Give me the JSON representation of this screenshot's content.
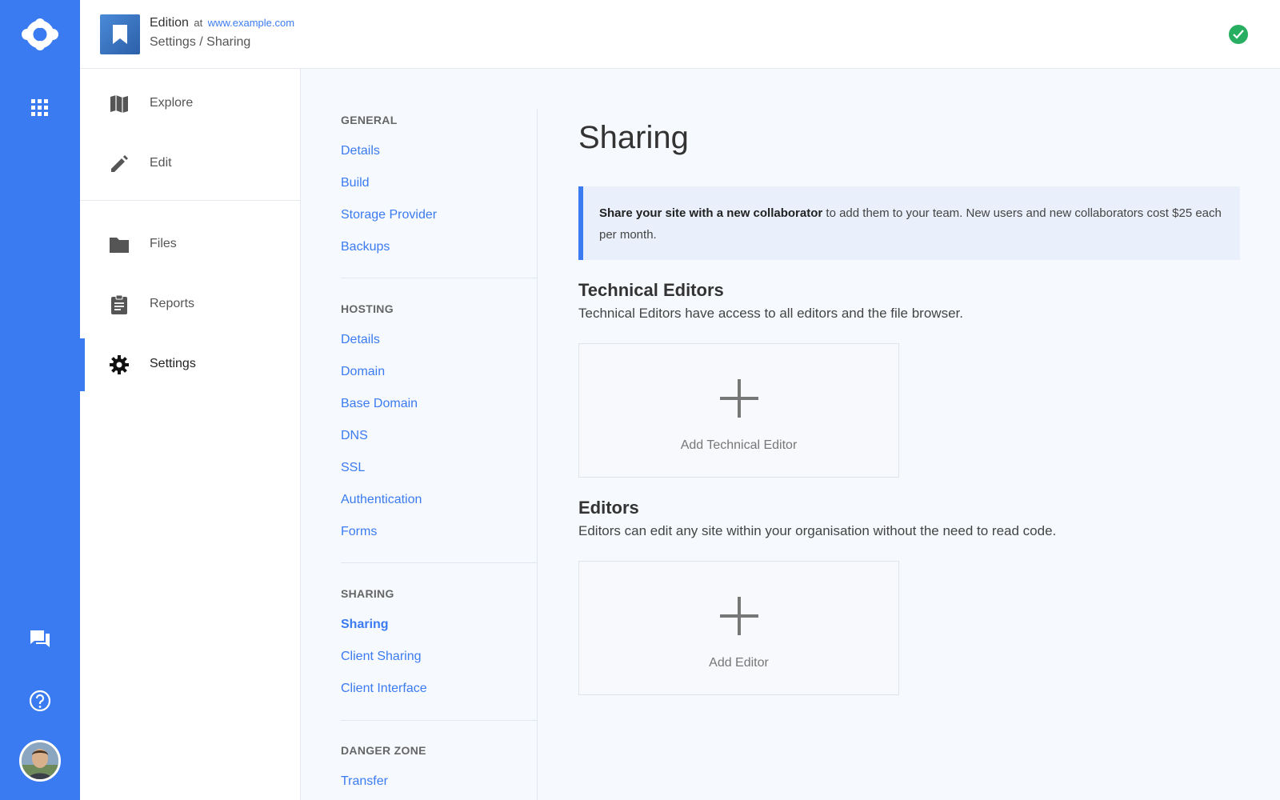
{
  "header": {
    "site_name": "Edition",
    "at": "at",
    "url": "www.example.com",
    "breadcrumb": "Settings / Sharing",
    "status_color": "#27ae60"
  },
  "rail": {
    "icons": [
      "logo-icon",
      "apps-grid-icon",
      "chat-icon",
      "help-icon",
      "avatar"
    ],
    "accent": "#3b7bf1"
  },
  "nav": {
    "items": [
      {
        "label": "Explore",
        "icon": "map-icon"
      },
      {
        "label": "Edit",
        "icon": "pencil-icon"
      },
      {
        "label": "Files",
        "icon": "folder-icon"
      },
      {
        "label": "Reports",
        "icon": "clipboard-icon"
      },
      {
        "label": "Settings",
        "icon": "gear-icon",
        "active": true
      }
    ]
  },
  "subnav": {
    "general": {
      "heading": "GENERAL",
      "links": [
        "Details",
        "Build",
        "Storage Provider",
        "Backups"
      ]
    },
    "hosting": {
      "heading": "HOSTING",
      "links": [
        "Details",
        "Domain",
        "Base Domain",
        "DNS",
        "SSL",
        "Authentication",
        "Forms"
      ]
    },
    "sharing": {
      "heading": "SHARING",
      "links": [
        "Sharing",
        "Client Sharing",
        "Client Interface"
      ]
    },
    "danger": {
      "heading": "DANGER ZONE",
      "links": [
        "Transfer"
      ]
    }
  },
  "main": {
    "title": "Sharing",
    "notice_bold": "Share your site with a new collaborator",
    "notice_rest": " to add them to your team. New users and new collaborators cost $25 each per month.",
    "technical": {
      "title": "Technical Editors",
      "desc": "Technical Editors have access to all editors and the file browser.",
      "add_label": "Add Technical Editor"
    },
    "editors": {
      "title": "Editors",
      "desc": "Editors can edit any site within your organisation without the need to read code.",
      "add_label": "Add Editor"
    }
  }
}
